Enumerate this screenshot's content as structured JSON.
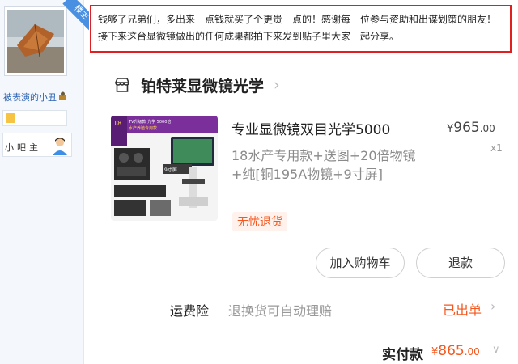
{
  "sidebar": {
    "owner_ribbon": "楼主",
    "username": "被表演的小丑",
    "bar_owner_label": "小吧主"
  },
  "post": {
    "text": "钱够了兄弟们，多出来一点钱就买了个更贵一点的！感谢每一位参与资助和出谋划策的朋友！接下来这台显微镜做出的任何成果都拍下来发到贴子里大家一起分享。"
  },
  "order": {
    "shop_name": "铂特莱显微镜光学",
    "product_title": "专业显微镜双目光学5000",
    "product_spec": "18水产专用款+送图+20倍物镜+纯[铜195A物镜+9寸屏]",
    "price_currency": "¥",
    "price_int": "965",
    "price_dec": ".00",
    "quantity": "x1",
    "return_tag": "无忧退货",
    "add_to_cart_label": "加入购物车",
    "refund_label": "退款",
    "shipping_insurance_label": "运费险",
    "shipping_insurance_desc": "退换货可自动理赔",
    "shipping_insurance_status": "已出单",
    "paid_label": "实付款",
    "paid_currency": "¥",
    "paid_int": "865",
    "paid_dec": ".00"
  },
  "thumbnail_text": {
    "badge": "18",
    "badge_sub": "水产养殖专用款",
    "banner": "TV升级款 光学 5000倍",
    "zoom_tag": "9寸屏"
  },
  "icons": {
    "store": "store-icon",
    "chevron": "chevron-right-icon",
    "chevron_down": "chevron-down-icon",
    "user_badge": "user-badge-icon",
    "bar_owner": "bar-owner-avatar-icon",
    "level": "level-badge-icon"
  },
  "colors": {
    "accent": "#f5571d",
    "highlight_border": "#e02020",
    "ribbon": "#4a90e2"
  }
}
